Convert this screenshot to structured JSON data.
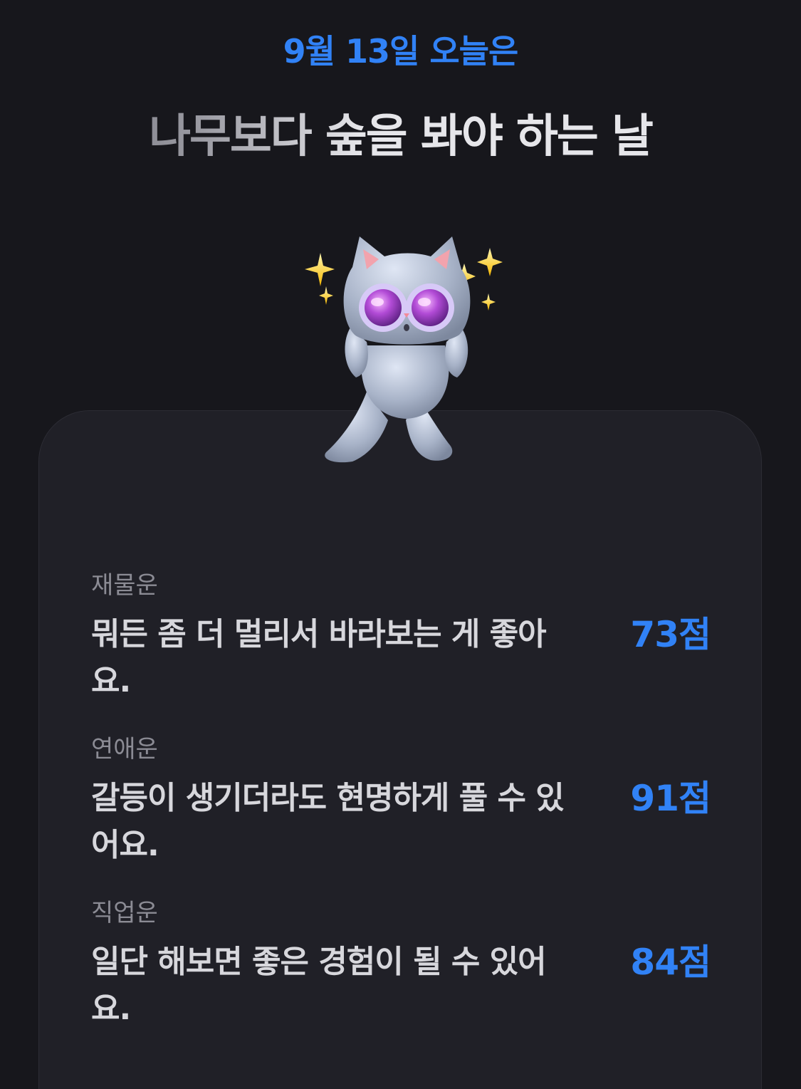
{
  "header": {
    "date_line": "9월 13일 오늘은",
    "headline": "나무보다 숲을 봐야 하는 날"
  },
  "mascot": {
    "icon": "cat-with-binoculars-icon"
  },
  "fortunes": [
    {
      "category": "재물운",
      "text": "뭐든 좀 더 멀리서 바라보는 게 좋아요.",
      "score_label": "73점",
      "score": 73
    },
    {
      "category": "연애운",
      "text": "갈등이 생기더라도 현명하게 풀 수 있어요.",
      "score_label": "91점",
      "score": 91
    },
    {
      "category": "직업운",
      "text": "일단 해보면 좋은 경험이 될 수 있어요.",
      "score_label": "84점",
      "score": 84
    }
  ],
  "colors": {
    "accent": "#3182f6",
    "background": "#17171c",
    "card": "#202027"
  }
}
